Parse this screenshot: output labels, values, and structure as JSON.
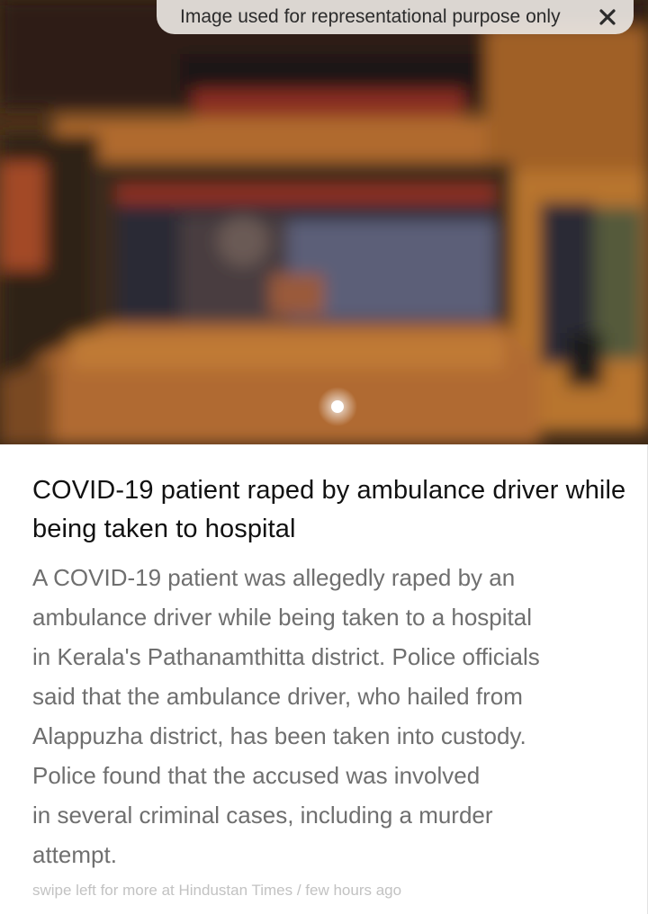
{
  "banner": {
    "disclaimer": "Image used for representational purpose only",
    "close_icon": "close-icon"
  },
  "article": {
    "headline": "COVID-19 patient raped by ambulance driver while being taken to hospital",
    "summary_lines": [
      "A COVID-19 patient was allegedly raped by an",
      "ambulance driver while being taken to a hospital",
      "in Kerala's Pathanamthitta district. Police officials",
      "said that the ambulance driver, who hailed from",
      "Alappuzha district, has been taken into custody.",
      "Police found that the accused was involved",
      "in several criminal cases, including a murder",
      "attempt."
    ],
    "footer": "swipe left for more at Hindustan Times / few hours ago"
  }
}
